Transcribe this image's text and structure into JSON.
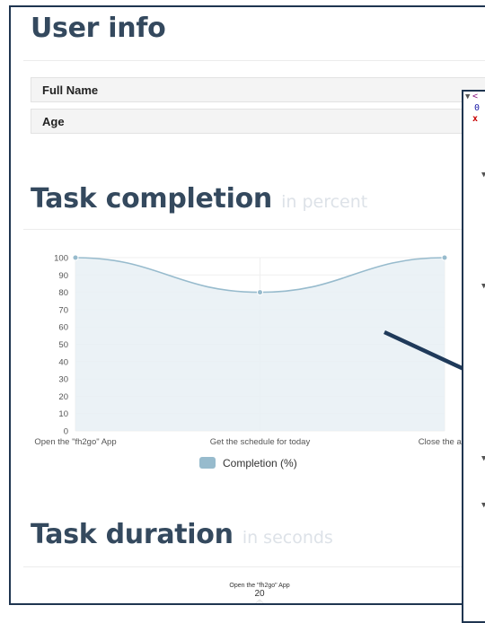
{
  "user_info": {
    "title": "User info",
    "fields": [
      {
        "label": "Full Name"
      },
      {
        "label": "Age"
      }
    ]
  },
  "completion_section": {
    "title": "Task completion",
    "subtitle": "in percent"
  },
  "duration_section": {
    "title": "Task duration",
    "subtitle": "in seconds",
    "first_slice_label": "Open the \"fh2go\" App",
    "first_slice_value": "20"
  },
  "devtools": {
    "line1": "<",
    "line2": "0",
    "line3": "x"
  },
  "chart_data": {
    "type": "area",
    "categories": [
      "Open the \"fh2go\" App",
      "Get the schedule for today",
      "Close the app"
    ],
    "x_tick_labels": [
      "Open the \"fh2go\" App",
      "Get the schedule for today",
      "Close the app"
    ],
    "y_ticks": [
      0,
      10,
      20,
      30,
      40,
      50,
      60,
      70,
      80,
      90,
      100
    ],
    "series": [
      {
        "name": "Completion (%)",
        "values": [
          100,
          80,
          100
        ],
        "color": "#97bbcd"
      }
    ],
    "ylim": [
      0,
      100
    ],
    "grid": true,
    "legend_position": "bottom"
  },
  "colors": {
    "heading": "#34495e",
    "subtitle": "#dde2e8",
    "series_stroke": "#97bbcd",
    "series_fill": "#e8f0f5",
    "frame": "#1f3550",
    "arrow": "#1f3a5a"
  }
}
